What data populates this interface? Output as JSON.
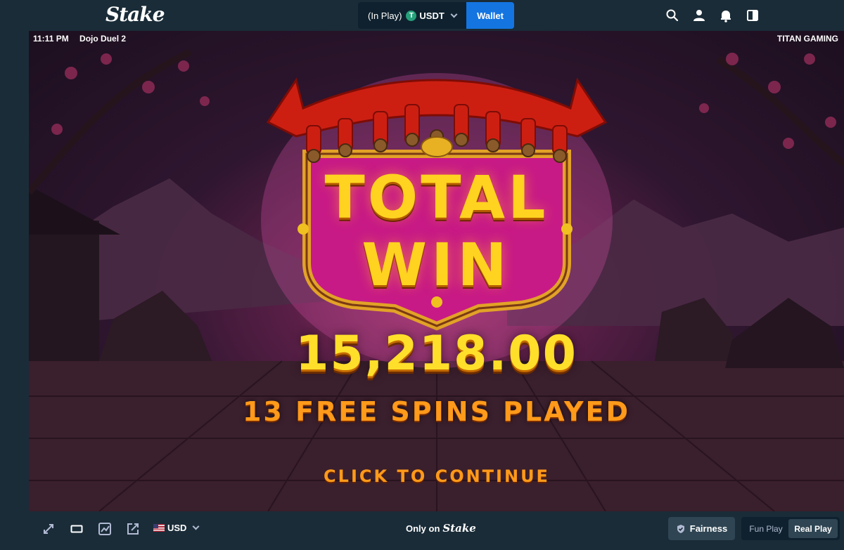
{
  "topbar": {
    "logo": "Stake",
    "balance_prefix": "(In Play)",
    "currency": "USDT",
    "currency_icon_letter": "T",
    "wallet_label": "Wallet",
    "icons": [
      "search-icon",
      "user-icon",
      "bell-icon",
      "sidebar-toggle-icon"
    ]
  },
  "game": {
    "time": "11:11 PM",
    "title": "Dojo Duel 2",
    "provider": "TITAN GAMING",
    "banner_line1": "TOTAL",
    "banner_line2": "WIN",
    "amount": "15,218.00",
    "spins_text": "13 FREE SPINS PLAYED",
    "continue_text": "CLICK TO CONTINUE"
  },
  "bottombar": {
    "icons": [
      "fullscreen-icon",
      "theatre-mode-icon",
      "stats-icon",
      "popout-icon"
    ],
    "currency_label": "USD",
    "only_on": "Only on",
    "only_on_brand": "Stake",
    "fairness_label": "Fairness",
    "fun_play_label": "Fun Play",
    "real_play_label": "Real Play"
  },
  "colors": {
    "bg_dark": "#0f212e",
    "panel": "#1a2c38",
    "wallet_blue": "#1475e1",
    "gold": "#ffd31f",
    "orange": "#ff9a1a"
  }
}
